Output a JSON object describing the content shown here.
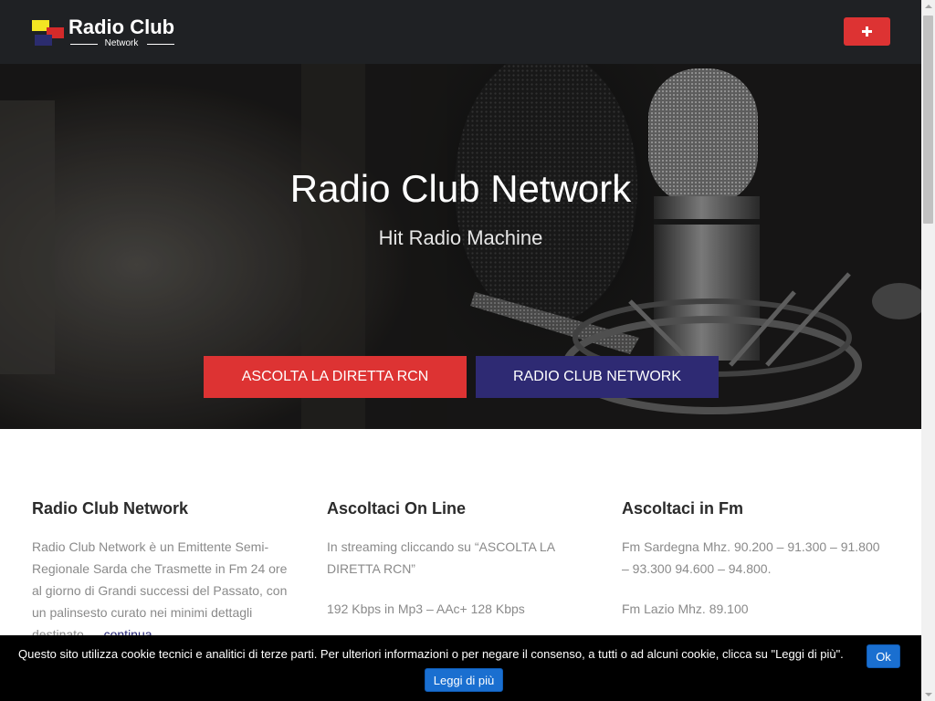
{
  "header": {
    "logo_title": "Radio Club",
    "logo_subtitle": "Network",
    "menu_button_icon": "plus-icon"
  },
  "hero": {
    "title": "Radio Club Network",
    "subtitle": "Hit Radio Machine",
    "buttons": [
      {
        "label": "ASCOLTA LA DIRETTA RCN"
      },
      {
        "label": "RADIO CLUB NETWORK"
      }
    ]
  },
  "columns": [
    {
      "heading": "Radio Club Network",
      "paragraphs": [
        "Radio Club Network è un Emittente Semi-Regionale Sarda che Trasmette in Fm 24 ore al giorno di Grandi successi del Passato, con un palinsesto curato nei minimi dettagli destinato …"
      ],
      "link": "continua"
    },
    {
      "heading": "Ascoltaci On Line",
      "paragraphs": [
        "In streaming cliccando su “ASCOLTA LA DIRETTA RCN”",
        "192 Kbps in Mp3 – AAc+ 128 Kbps"
      ]
    },
    {
      "heading": "Ascoltaci in Fm",
      "paragraphs": [
        "Fm Sardegna Mhz. 90.200 – 91.300 – 91.800 – 93.300 94.600 – 94.800.",
        "Fm Lazio Mhz. 89.100"
      ]
    }
  ],
  "cookie_banner": {
    "text": "Questo sito utilizza cookie tecnici e analitici di terze parti. Per ulteriori informazioni o per negare il consenso, a tutti o ad alcuni cookie, clicca su \"Leggi di più\".",
    "ok_label": "Ok",
    "more_label": "Leggi di più"
  },
  "colors": {
    "accent_red": "#dd3333",
    "accent_navy": "#2e2a73",
    "header_bg": "#1f2124",
    "cookie_button": "#1a6fd0"
  }
}
